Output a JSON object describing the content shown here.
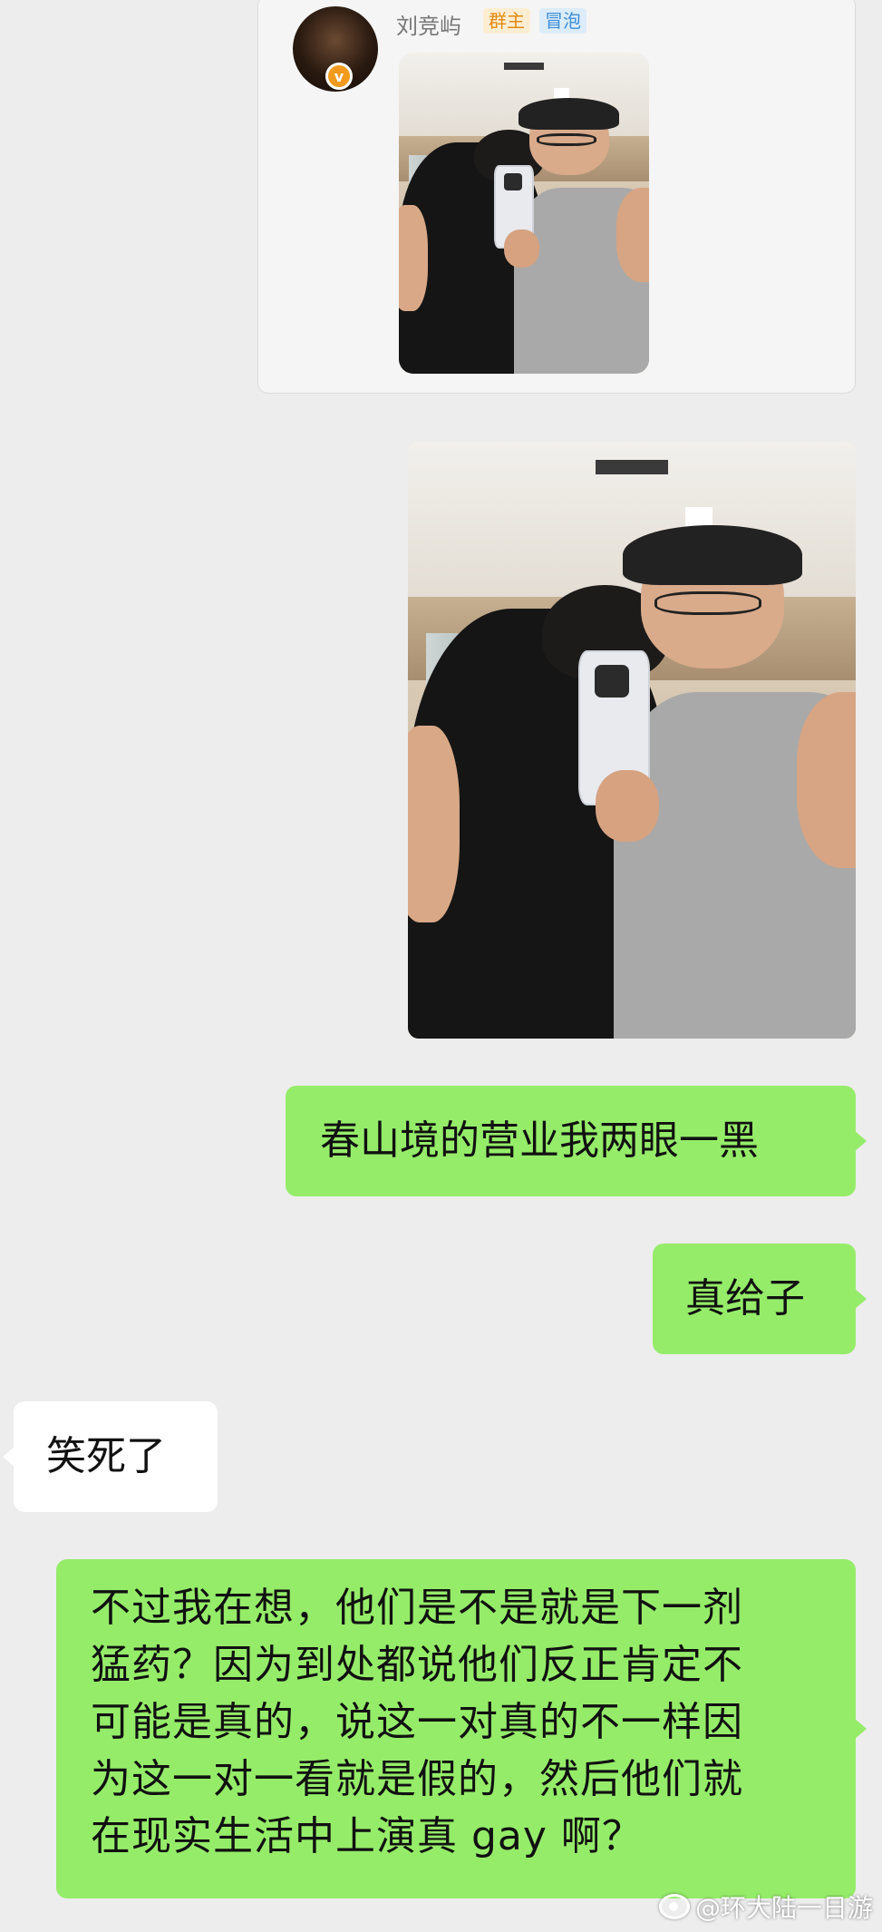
{
  "quote": {
    "poster_name": "刘竞屿",
    "badge_owner": "群主",
    "badge_bubble": "冒泡",
    "avatar_icon": "avatar-photo",
    "verified_mark": "v",
    "verified_color": "#f39a1e"
  },
  "messages": [
    {
      "direction": "out",
      "text": "春山境的营业我两眼一黑"
    },
    {
      "direction": "out",
      "text": "真给子"
    },
    {
      "direction": "in",
      "text": "笑死了"
    },
    {
      "direction": "out",
      "lines": [
        "不过我在想，他们是不是就是下一剂",
        "猛药？因为到处都说他们反正肯定不",
        "可能是真的，说这一对真的不一样因",
        "为这一对一看就是假的，然后他们就",
        "在现实生活中上演真 gay 啊？"
      ]
    }
  ],
  "watermark": {
    "text": "@环大陆一日游",
    "icon": "weibo-icon"
  },
  "colors": {
    "background": "#ededed",
    "outgoing_bubble": "#95ec69",
    "incoming_bubble": "#ffffff"
  }
}
